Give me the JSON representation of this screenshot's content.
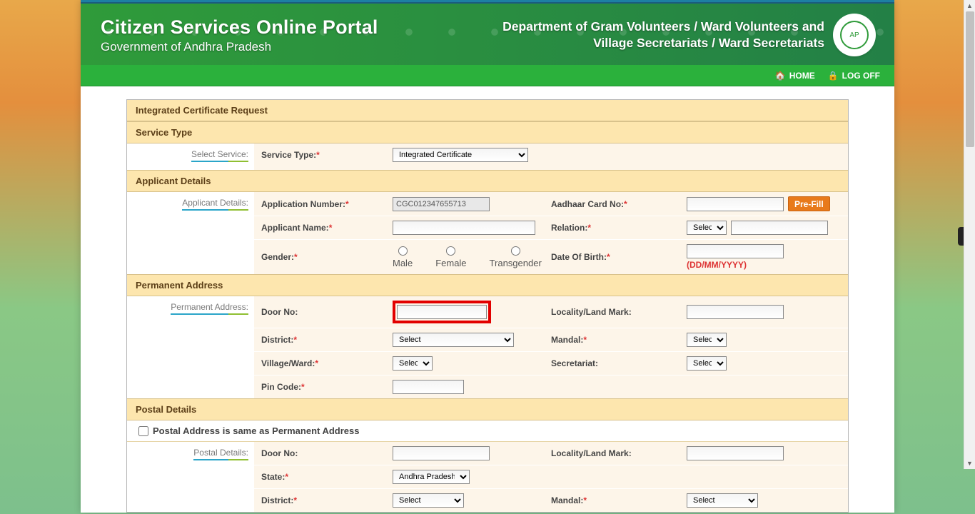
{
  "banner": {
    "title": "Citizen Services Online Portal",
    "subtitle": "Government of Andhra Pradesh",
    "dept_line1": "Department of Gram Volunteers / Ward Volunteers and",
    "dept_line2": "Village Secretariats / Ward Secretariats"
  },
  "nav": {
    "home": "HOME",
    "logoff": "LOG OFF"
  },
  "headers": {
    "page": "Integrated Certificate Request",
    "service_type": "Service Type",
    "applicant_details": "Applicant Details",
    "permanent_address": "Permanent Address",
    "postal_details": "Postal Details"
  },
  "labels": {
    "select_service": "Select Service:",
    "service_type": "Service Type:",
    "applicant_details": "Applicant Details:",
    "application_number": "Application Number:",
    "aadhaar": "Aadhaar Card No:",
    "applicant_name": "Applicant Name:",
    "relation": "Relation:",
    "gender": "Gender:",
    "dob": "Date Of Birth:",
    "permanent_address": "Permanent Address:",
    "door_no": "Door No:",
    "locality": "Locality/Land Mark:",
    "district": "District:",
    "mandal": "Mandal:",
    "village_ward": "Village/Ward:",
    "secretariat": "Secretariat:",
    "pin_code": "Pin Code:",
    "postal_same": "Postal Address is same as Permanent Address",
    "postal_details": "Postal Details:",
    "state": "State:"
  },
  "options": {
    "service_type_selected": "Integrated Certificate",
    "relation_selected": "Select",
    "gender_male": "Male",
    "gender_female": "Female",
    "gender_trans": "Transgender",
    "district_selected": "Select",
    "mandal_selected": "Select",
    "village_selected": "Select",
    "secretariat_selected": "Select",
    "state_selected": "Andhra Pradesh",
    "postal_district_selected": "Select",
    "postal_mandal_selected": "Select"
  },
  "values": {
    "application_number": "CGC012347655713",
    "aadhaar": "",
    "applicant_name": "",
    "relation_name": "",
    "dob": "",
    "dob_hint": "(DD/MM/YYYY)",
    "door_no": "",
    "locality": "",
    "pin_code": "",
    "postal_door_no": "",
    "postal_locality": ""
  },
  "buttons": {
    "prefill": "Pre-Fill"
  }
}
